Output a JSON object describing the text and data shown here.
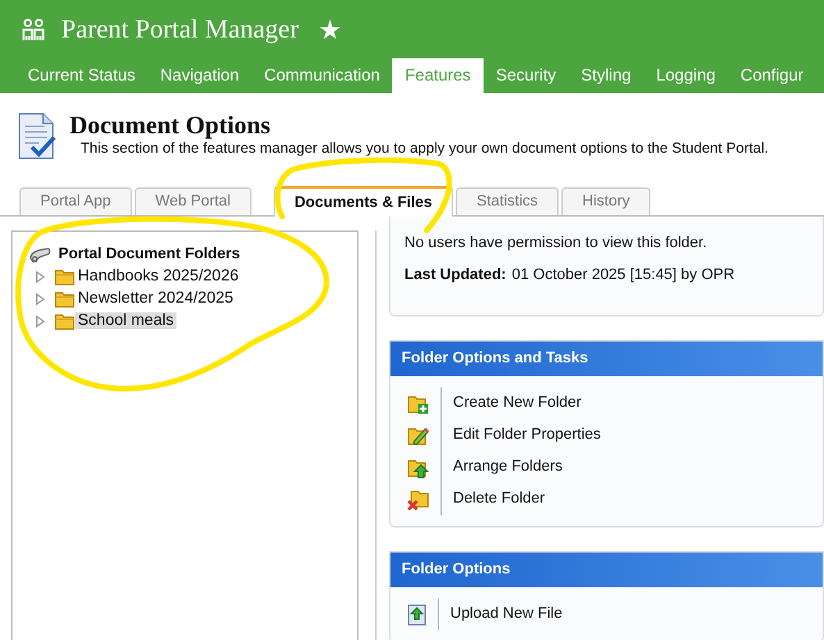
{
  "app": {
    "title": "Parent Portal Manager",
    "star": "★"
  },
  "nav": [
    {
      "label": "Current Status",
      "selected": false
    },
    {
      "label": "Navigation",
      "selected": false
    },
    {
      "label": "Communication",
      "selected": false
    },
    {
      "label": "Features",
      "selected": true
    },
    {
      "label": "Security",
      "selected": false
    },
    {
      "label": "Styling",
      "selected": false
    },
    {
      "label": "Logging",
      "selected": false
    },
    {
      "label": "Configur",
      "selected": false
    }
  ],
  "page": {
    "title": "Document Options",
    "description": "This section of the features manager allows you to apply your own document options to the Student Portal."
  },
  "tabs": [
    {
      "label": "Portal App",
      "selected": false
    },
    {
      "label": "Web Portal",
      "selected": false
    },
    {
      "label": "Documents & Files",
      "selected": true
    },
    {
      "label": "Statistics",
      "selected": false
    },
    {
      "label": "History",
      "selected": false
    }
  ],
  "tree": {
    "label": "Portal Document Folders",
    "children": [
      {
        "label": "Handbooks 2025/2026",
        "expanded": false,
        "selected": false
      },
      {
        "label": "Newsletter 2024/2025",
        "expanded": false,
        "selected": false
      },
      {
        "label": "School meals",
        "expanded": false,
        "selected": true
      }
    ]
  },
  "folder_info": {
    "permissions": "No users have permission to view this folder.",
    "updated_label": "Last Updated:",
    "updated_value": "01 October 2025 [15:45] by OPR"
  },
  "panels": [
    {
      "title": "Folder Options and Tasks",
      "items": [
        {
          "label": "Create New Folder",
          "kind": "create"
        },
        {
          "label": "Edit Folder Properties",
          "kind": "edit"
        },
        {
          "label": "Arrange Folders",
          "kind": "arrange"
        },
        {
          "label": "Delete Folder",
          "kind": "delete"
        }
      ]
    },
    {
      "title": "Folder Options",
      "items": [
        {
          "label": "Upload New File",
          "kind": "upload"
        }
      ]
    }
  ],
  "annotations": [
    {
      "kind": "loop"
    },
    {
      "kind": "loop"
    }
  ]
}
